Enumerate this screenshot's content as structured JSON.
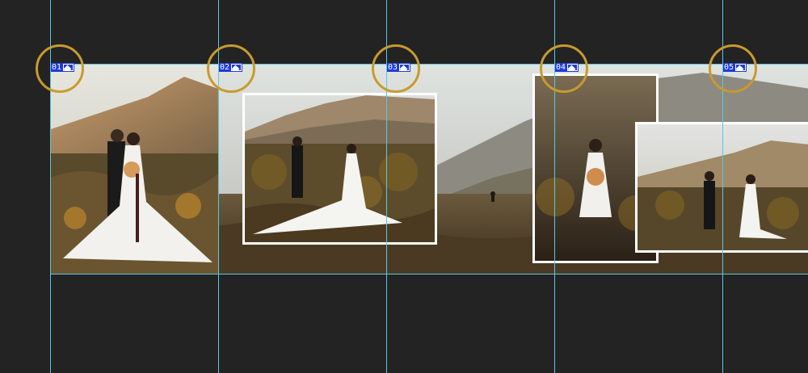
{
  "frames": [
    {
      "number": "01",
      "icon": "image-icon"
    },
    {
      "number": "02",
      "icon": "image-icon"
    },
    {
      "number": "03",
      "icon": "image-icon"
    },
    {
      "number": "04",
      "icon": "image-icon"
    },
    {
      "number": "05",
      "icon": "image-icon"
    }
  ],
  "colors": {
    "background": "#232323",
    "guide": "#57c8e6",
    "label_bg": "#1f3bd6",
    "highlight_ring": "#c99a2e"
  }
}
